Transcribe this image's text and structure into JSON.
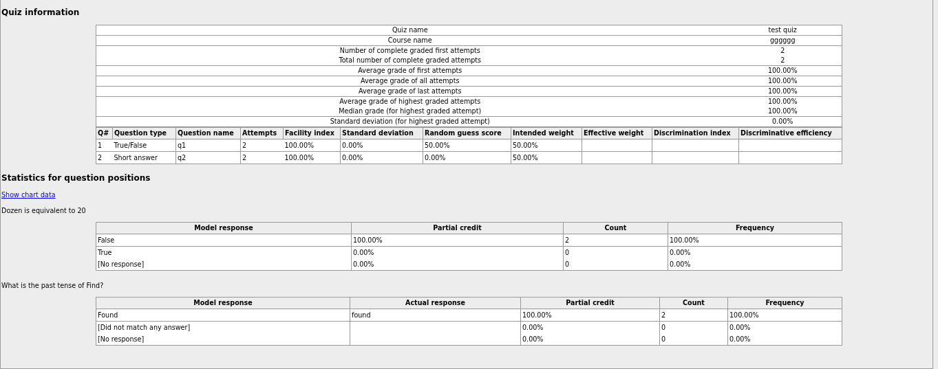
{
  "quiz_information": {
    "heading": "Quiz information",
    "info_groups": [
      [
        {
          "label": "Quiz name",
          "value": "test quiz"
        }
      ],
      [
        {
          "label": "Course name",
          "value": "gggggg"
        }
      ],
      [
        {
          "label": "Number of complete graded first attempts",
          "value": "2"
        },
        {
          "label": "Total number of complete graded attempts",
          "value": "2"
        }
      ],
      [
        {
          "label": "Average grade of first attempts",
          "value": "100.00%"
        }
      ],
      [
        {
          "label": "Average grade of all attempts",
          "value": "100.00%"
        }
      ],
      [
        {
          "label": "Average grade of last attempts",
          "value": "100.00%"
        }
      ],
      [
        {
          "label": "Average grade of highest graded attempts",
          "value": "100.00%"
        },
        {
          "label": "Median grade (for highest graded attempt)",
          "value": "100.00%"
        }
      ],
      [
        {
          "label": "Standard deviation (for highest graded attempt)",
          "value": "0.00%"
        }
      ]
    ],
    "question_table": {
      "columns": [
        "Q#",
        "Question type",
        "Question name",
        "Attempts",
        "Facility index",
        "Standard deviation",
        "Random guess score",
        "Intended weight",
        "Effective weight",
        "Discrimination index",
        "Discriminative efficiency"
      ],
      "rows": [
        [
          "1",
          "True/False",
          "q1",
          "2",
          "100.00%",
          "0.00%",
          "50.00%",
          "50.00%"
        ],
        [
          "2",
          "Short answer",
          "q2",
          "2",
          "100.00%",
          "0.00%",
          "0.00%",
          "50.00%"
        ]
      ]
    }
  },
  "question_positions": {
    "heading": "Statistics for question positions",
    "link": "Show chart data",
    "questions": [
      {
        "text": "Dozen is equivalent to 20",
        "columns": {
          "model_response": "Model response",
          "partial_credit": "Partial credit",
          "count": "Count",
          "frequency": "Frequency"
        },
        "groups": [
          [
            {
              "model_response": "False",
              "partial_credit": "100.00%",
              "count": "2",
              "frequency": "100.00%"
            }
          ],
          [
            {
              "model_response": "True",
              "partial_credit": "0.00%",
              "count": "0",
              "frequency": "0.00%"
            },
            {
              "model_response": "[No response]",
              "partial_credit": "0.00%",
              "count": "0",
              "frequency": "0.00%"
            }
          ]
        ]
      },
      {
        "text": "What is the past tense of Find?",
        "columns": {
          "model_response": "Model response",
          "actual_response": "Actual response",
          "partial_credit": "Partial credit",
          "count": "Count",
          "frequency": "Frequency"
        },
        "groups": [
          [
            {
              "model_response": "Found",
              "actual_response": "found",
              "partial_credit": "100.00%",
              "count": "2",
              "frequency": "100.00%"
            }
          ],
          [
            {
              "model_response": "[Did not match any answer]",
              "partial_credit": "0.00%",
              "count": "0",
              "frequency": "0.00%"
            },
            {
              "model_response": "[No response]",
              "partial_credit": "0.00%",
              "count": "0",
              "frequency": "0.00%"
            }
          ]
        ]
      }
    ]
  }
}
